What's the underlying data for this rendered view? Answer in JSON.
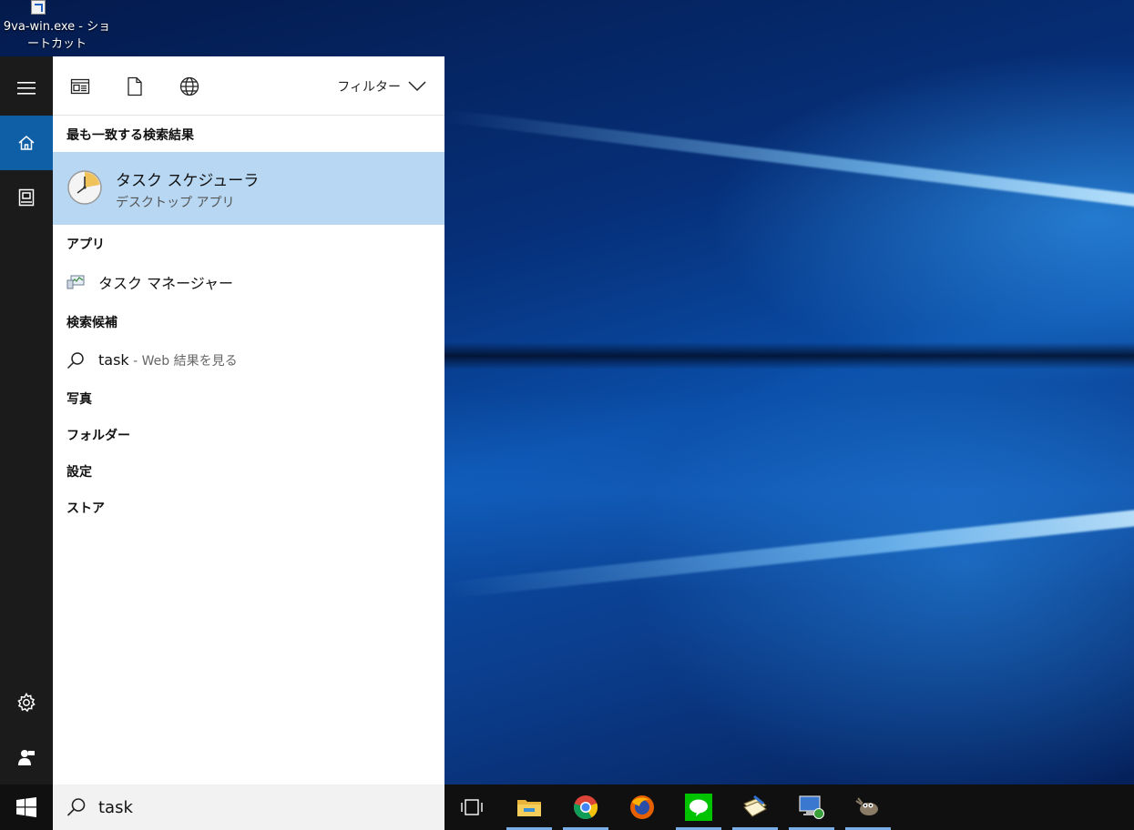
{
  "desktop": {
    "shortcut_label": "9va-win.exe - ショートカット"
  },
  "rail": {
    "items": [
      {
        "name": "menu",
        "icon": "hamburger-icon"
      },
      {
        "name": "home",
        "icon": "home-icon",
        "active": true
      },
      {
        "name": "notebook",
        "icon": "notebook-icon"
      },
      {
        "name": "settings",
        "icon": "gear-icon"
      },
      {
        "name": "feedback",
        "icon": "feedback-icon"
      }
    ]
  },
  "search_panel": {
    "filter_icons": [
      "apps-filter-icon",
      "documents-filter-icon",
      "web-filter-icon"
    ],
    "filter_label": "フィルター",
    "best_match_header": "最も一致する検索結果",
    "best_match": {
      "title": "タスク スケジューラ",
      "subtitle": "デスクトップ アプリ",
      "icon": "clock-icon"
    },
    "apps_header": "アプリ",
    "apps": [
      {
        "label": "タスク マネージャー",
        "icon": "task-manager-icon"
      }
    ],
    "suggestions_header": "検索候補",
    "suggestion": {
      "query": "task",
      "suffix": " - Web 結果を見る",
      "icon": "search-icon"
    },
    "categories": [
      "写真",
      "フォルダー",
      "設定",
      "ストア"
    ]
  },
  "taskbar": {
    "search_value": "task",
    "apps": [
      {
        "name": "task-view",
        "icon": "task-view-icon",
        "running": false
      },
      {
        "name": "file-explorer",
        "icon": "folder-icon",
        "running": true
      },
      {
        "name": "chrome",
        "icon": "chrome-icon",
        "running": true
      },
      {
        "name": "firefox",
        "icon": "firefox-icon",
        "running": false
      },
      {
        "name": "line",
        "icon": "line-icon",
        "running": true
      },
      {
        "name": "notepad-app",
        "icon": "notepad-icon",
        "running": true
      },
      {
        "name": "remote-desktop",
        "icon": "remote-desktop-icon",
        "running": true
      },
      {
        "name": "gimp",
        "icon": "gimp-icon",
        "running": true
      }
    ]
  },
  "colors": {
    "accent": "#0e5fa6",
    "selection": "#b7d7f2",
    "taskbar": "#101010",
    "rail": "#1b1b1b"
  }
}
